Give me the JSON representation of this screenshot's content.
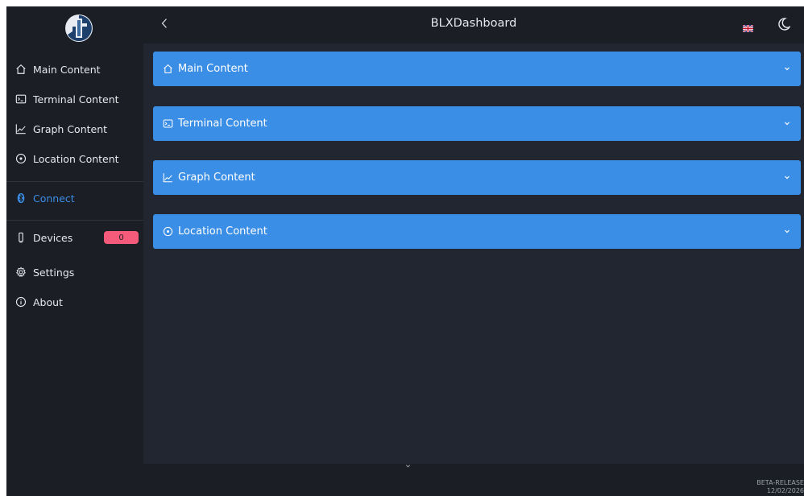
{
  "header": {
    "title": "BLXDashboard",
    "back_icon": "chevron-left-icon",
    "language_icon": "uk-flag-icon",
    "theme_icon": "moon-icon"
  },
  "sidebar": {
    "logo": "app-logo",
    "items": [
      {
        "label": "Main Content",
        "icon": "home-icon"
      },
      {
        "label": "Terminal Content",
        "icon": "terminal-icon"
      },
      {
        "label": "Graph Content",
        "icon": "graph-icon"
      },
      {
        "label": "Location Content",
        "icon": "location-icon"
      }
    ],
    "connect": {
      "label": "Connect",
      "icon": "bluetooth-icon",
      "color": "#3b8ee6"
    },
    "devices": {
      "label": "Devices",
      "icon": "device-icon",
      "count": "0"
    },
    "settings": {
      "label": "Settings",
      "icon": "gear-icon"
    },
    "about": {
      "label": "About",
      "icon": "info-icon"
    }
  },
  "main": {
    "panels": [
      {
        "label": "Main Content",
        "icon": "home-icon"
      },
      {
        "label": "Terminal Content",
        "icon": "terminal-icon"
      },
      {
        "label": "Graph Content",
        "icon": "graph-icon"
      },
      {
        "label": "Location Content",
        "icon": "location-icon"
      }
    ]
  },
  "footer": {
    "version_line1": "BETA-RELEASE",
    "version_line2": "12/02/2026"
  },
  "colors": {
    "accent": "#3b8ee6",
    "badge": "#f45b7a",
    "background": "#1b1e25",
    "content_background": "#222630"
  }
}
